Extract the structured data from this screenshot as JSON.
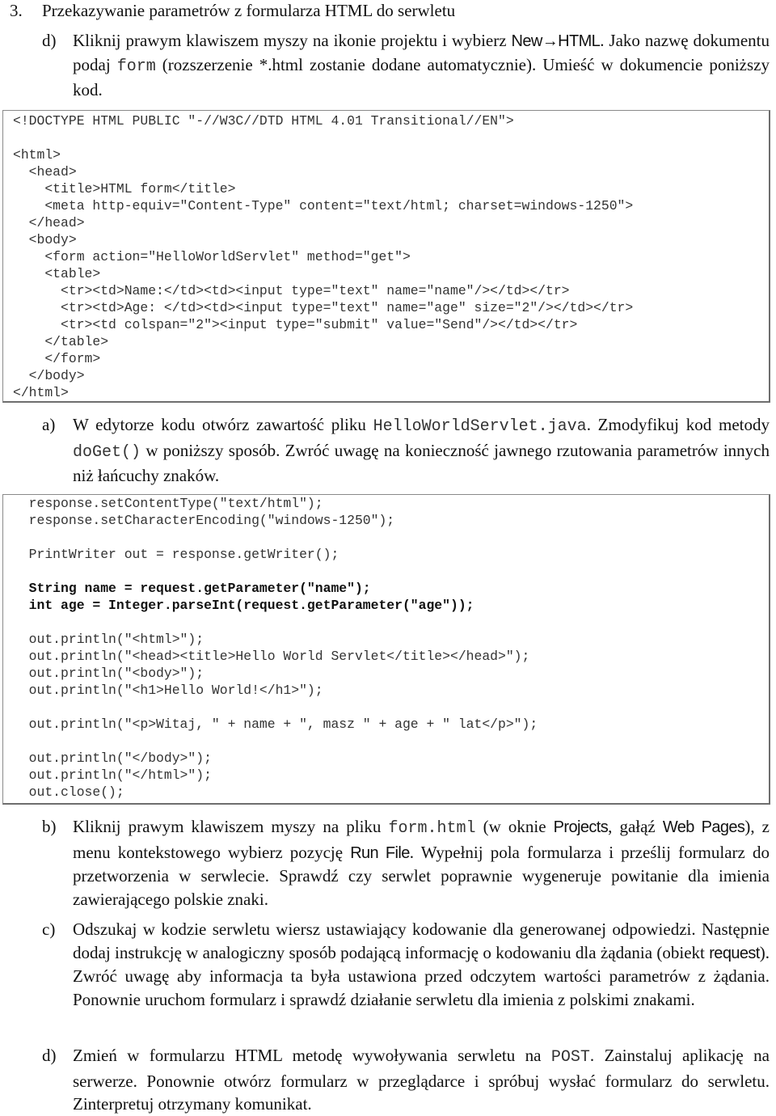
{
  "heading": {
    "number": "3.",
    "title": "Przekazywanie parametrów z formularza HTML do serwletu"
  },
  "step_d1": {
    "marker": "d)",
    "text_1": "Kliknij prawym klawiszem myszy na ikonie projektu i wybierz ",
    "menu_path": "New→HTML",
    "text_2": ". Jako nazwę dokumentu podaj ",
    "doc_name": "form",
    "text_3": " (rozszerzenie *.html zostanie dodane automatycznie). Umieść w dokumencie poniższy kod."
  },
  "html_code": {
    "lines": [
      {
        "text": "<!DOCTYPE HTML PUBLIC \"-//W3C//DTD HTML 4.01 Transitional//EN\">",
        "bold": false
      },
      {
        "text": "",
        "bold": false
      },
      {
        "text": "<html>",
        "bold": false
      },
      {
        "text": "  <head>",
        "bold": false
      },
      {
        "text": "    <title>HTML form</title>",
        "bold": false
      },
      {
        "text": "    <meta http-equiv=\"Content-Type\" content=\"text/html; charset=windows-1250\">",
        "bold": false
      },
      {
        "text": "  </head>",
        "bold": false
      },
      {
        "text": "  <body>",
        "bold": false
      },
      {
        "text": "    <form action=\"HelloWorldServlet\" method=\"get\">",
        "bold": false
      },
      {
        "text": "    <table>",
        "bold": false
      },
      {
        "text": "      <tr><td>Name:</td><td><input type=\"text\" name=\"name\"/></td></tr>",
        "bold": false
      },
      {
        "text": "      <tr><td>Age: </td><td><input type=\"text\" name=\"age\" size=\"2\"/></td></tr>",
        "bold": false
      },
      {
        "text": "      <tr><td colspan=\"2\"><input type=\"submit\" value=\"Send\"/></td></tr>",
        "bold": false
      },
      {
        "text": "    </table>",
        "bold": false
      },
      {
        "text": "    </form>",
        "bold": false
      },
      {
        "text": "  </body>",
        "bold": false
      },
      {
        "text": "</html>",
        "bold": false
      }
    ]
  },
  "step_a": {
    "marker": "a)",
    "text_1": "W edytorze kodu otwórz zawartość pliku ",
    "file_name": "HelloWorldServlet.java",
    "text_2": ". Zmodyfikuj kod metody ",
    "method_name": "doGet()",
    "text_3": " w poniższy sposób. Zwróć uwagę na konieczność jawnego rzutowania parametrów innych niż łańcuchy znaków."
  },
  "java_code": {
    "lines": [
      {
        "text": "  response.setContentType(\"text/html\");",
        "bold": false
      },
      {
        "text": "  response.setCharacterEncoding(\"windows-1250\");",
        "bold": false
      },
      {
        "text": "",
        "bold": false
      },
      {
        "text": "  PrintWriter out = response.getWriter();",
        "bold": false
      },
      {
        "text": "",
        "bold": false
      },
      {
        "text": "  String name = request.getParameter(\"name\");",
        "bold": true
      },
      {
        "text": "  int age = Integer.parseInt(request.getParameter(\"age\"));",
        "bold": true
      },
      {
        "text": "",
        "bold": false
      },
      {
        "text": "  out.println(\"<html>\");",
        "bold": false
      },
      {
        "text": "  out.println(\"<head><title>Hello World Servlet</title></head>\");",
        "bold": false
      },
      {
        "text": "  out.println(\"<body>\");",
        "bold": false
      },
      {
        "text": "  out.println(\"<h1>Hello World!</h1>\");",
        "bold": false
      },
      {
        "text": "",
        "bold": false
      },
      {
        "text": "  out.println(\"<p>Witaj, \" + name + \", masz \" + age + \" lat</p>\");",
        "bold": false
      },
      {
        "text": "",
        "bold": false
      },
      {
        "text": "  out.println(\"</body>\");",
        "bold": false
      },
      {
        "text": "  out.println(\"</html>\");",
        "bold": false
      },
      {
        "text": "  out.close();",
        "bold": false
      }
    ]
  },
  "step_b": {
    "marker": "b)",
    "text_1": "Kliknij prawym klawiszem myszy na pliku ",
    "file_name": "form.html",
    "text_2": " (w oknie ",
    "window_name": "Projects",
    "text_3": ", gałąź ",
    "branch_name": "Web Pages",
    "text_4": "), z menu kontekstowego wybierz pozycję ",
    "menu_item": "Run File",
    "text_5": ". Wypełnij pola formularza i prześlij formularz do przetworzenia w serwlecie. Sprawdź czy serwlet poprawnie wygeneruje powitanie dla imienia zawierającego polskie znaki."
  },
  "step_c": {
    "marker": "c)",
    "text_1": "Odszukaj w kodzie serwletu wiersz ustawiający kodowanie dla generowanej odpowiedzi. Następnie dodaj instrukcję w analogiczny sposób podającą informację o kodowaniu dla żądania (obiekt ",
    "object_name": "request",
    "text_2": "). Zwróć uwagę aby informacja ta była ustawiona przed odczytem wartości parametrów z żądania. Ponownie uruchom formularz i sprawdź działanie serwletu dla imienia z polskimi znakami."
  },
  "step_d2": {
    "marker": "d)",
    "text_1": "Zmień w formularzu HTML metodę wywoływania serwletu na ",
    "method": "POST",
    "text_2": ". Zainstaluj aplikację na serwerze. Ponownie otwórz formularz w przeglądarce i spróbuj wysłać formularz do serwletu. Zinterpretuj otrzymany komunikat."
  }
}
